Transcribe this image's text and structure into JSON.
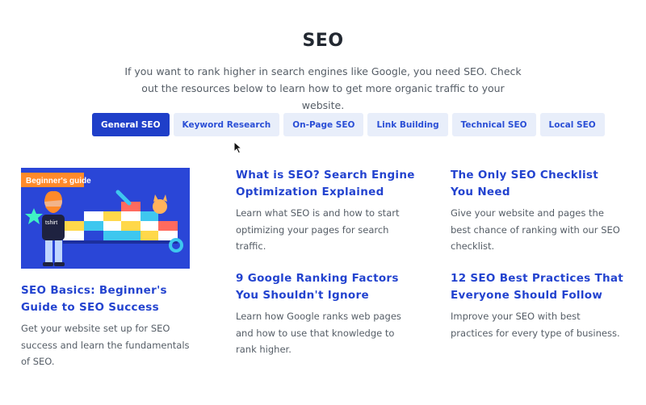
{
  "page": {
    "title": "SEO",
    "intro": "If you want to rank higher in search engines like Google, you need SEO. Check out the resources below to learn how to get more organic traffic to your website."
  },
  "tabs": [
    {
      "label": "General SEO",
      "active": true
    },
    {
      "label": "Keyword Research"
    },
    {
      "label": "On-Page SEO"
    },
    {
      "label": "Link Building"
    },
    {
      "label": "Technical SEO"
    },
    {
      "label": "Local SEO"
    }
  ],
  "hero": {
    "badge": "Beginner's guide",
    "shirt": "tshirt",
    "bg_color": "#2a46d7"
  },
  "articles": [
    {
      "title": "SEO Basics: Beginner's Guide to SEO Success",
      "description": "Get your website set up for SEO success and learn the fundamentals of SEO."
    },
    {
      "title": "What is SEO? Search Engine Optimization Explained",
      "description": "Learn what SEO is and how to start optimizing your pages for search traffic."
    },
    {
      "title": "The Only SEO Checklist You Need",
      "description": "Give your website and pages the best chance of ranking with our SEO checklist."
    },
    {
      "title": "9 Google Ranking Factors You Shouldn't Ignore",
      "description": "Learn how Google ranks web pages and how to use that knowledge to rank higher."
    },
    {
      "title": "12 SEO Best Practices That Everyone Should Follow",
      "description": "Improve your SEO with best practices for every type of business."
    }
  ],
  "colors": {
    "accent": "#1f3fc9",
    "link": "#2343cf",
    "tab_bg": "#e8eefa"
  }
}
